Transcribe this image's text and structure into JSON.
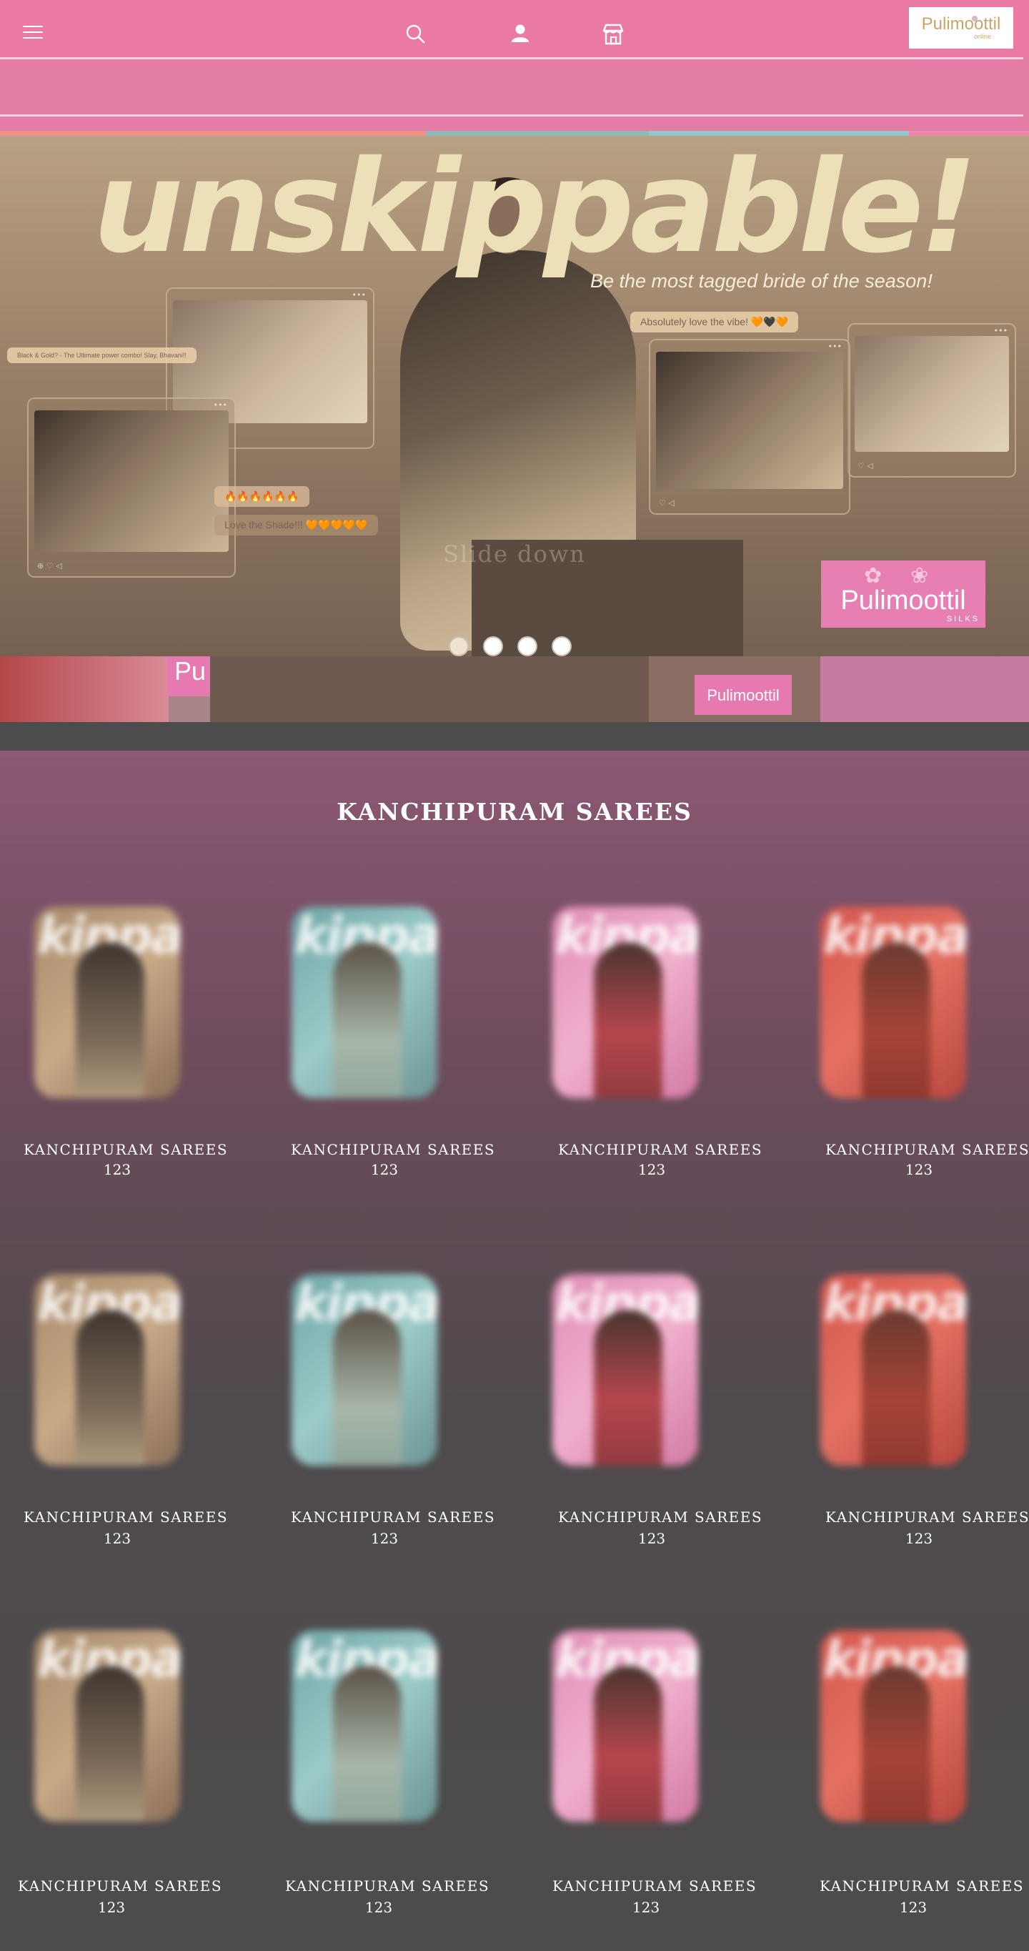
{
  "header": {
    "menu_icon": "hamburger-menu-icon",
    "search_icon": "search-icon",
    "account_icon": "user-icon",
    "store_icon": "store-icon",
    "logo_text": "Pulimoottil",
    "logo_subtext": "online",
    "background_color": "#ea7aa4"
  },
  "hero": {
    "headline": "unskippable!",
    "tagline": "Be the most tagged bride of the season!",
    "comment_1": "Black & Gold? - The Ultimate power combo! Slay, Bhavani!!",
    "comment_2": "Absolutely love the vibe! 🧡🖤🧡",
    "comment_3": "Love the Shade!!! 🧡🧡🧡🧡🧡",
    "comment_4": "🔥🔥🔥🔥🔥🔥",
    "overlay_text": "Slide down",
    "brand_logo": "Pulimoottil",
    "brand_logo_sub": "SILKS",
    "slide_count": 4,
    "active_slide": 1
  },
  "bottom_strip": {
    "logo_partial": "Pu",
    "logo_small": "Pulimoottil"
  },
  "products_section": {
    "title": "KANCHIPURAM SAREES",
    "items": [
      {
        "name": "KANCHIPURAM SAREES",
        "price": "123",
        "theme": "gold"
      },
      {
        "name": "KANCHIPURAM SAREES",
        "price": "123",
        "theme": "teal"
      },
      {
        "name": "KANCHIPURAM SAREES",
        "price": "123",
        "theme": "pink"
      },
      {
        "name": "KANCHIPURAM SAREES",
        "price": "123",
        "theme": "red"
      },
      {
        "name": "KANCHIPURAM SAREES",
        "price": "123",
        "theme": "gold"
      },
      {
        "name": "KANCHIPURAM SAREES",
        "price": "123",
        "theme": "teal"
      },
      {
        "name": "KANCHIPURAM SAREES",
        "price": "123",
        "theme": "pink"
      },
      {
        "name": "KANCHIPURAM SAREES",
        "price": "123",
        "theme": "red"
      },
      {
        "name": "KANCHIPURAM SAREES",
        "price": "123",
        "theme": "gold"
      },
      {
        "name": "KANCHIPURAM SAREES",
        "price": "123",
        "theme": "teal"
      },
      {
        "name": "KANCHIPURAM SAREES",
        "price": "123",
        "theme": "pink"
      },
      {
        "name": "KANCHIPURAM SAREES",
        "price": "123",
        "theme": "red"
      }
    ],
    "thumbnail_brand_text": "kippa"
  }
}
